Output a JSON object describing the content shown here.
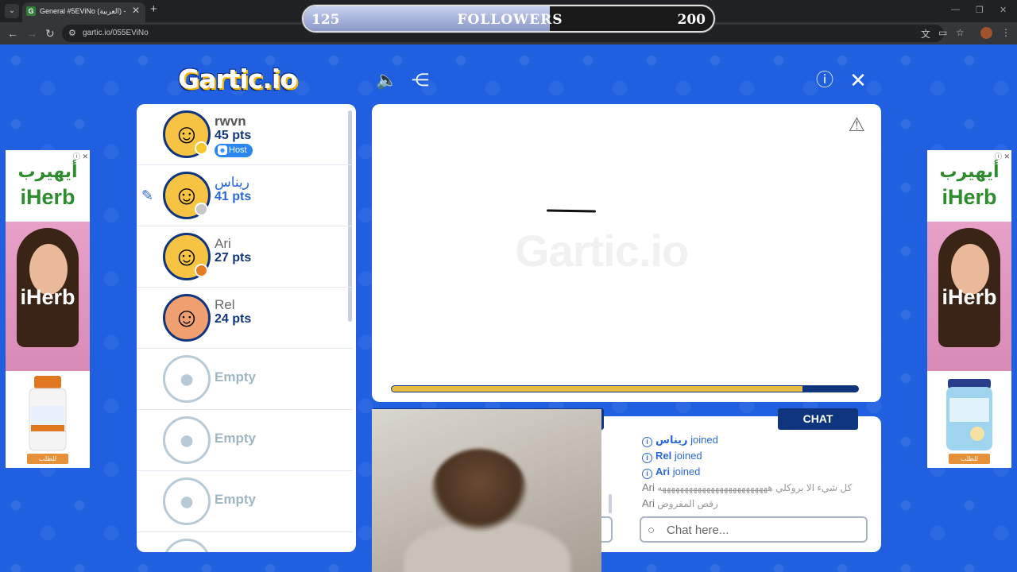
{
  "browser": {
    "tab_title": "General #5EViNo (العربية) - Gar",
    "url": "gartic.io/055EViNo"
  },
  "followers": {
    "current": "125",
    "label": "FOLLOWERS",
    "goal": "200",
    "progress": 0.6
  },
  "logo": "Gartic.io",
  "players": [
    {
      "name": "rwvn",
      "points": "45 pts",
      "host_label": "Host",
      "status_color": "#f6c82a"
    },
    {
      "name": "ريناس",
      "points": "41 pts",
      "drawing": true,
      "status_color": "#c7c7c7"
    },
    {
      "name": "Ari",
      "points": "27 pts",
      "status_color": "#e57d1e"
    },
    {
      "name": "Rel",
      "points": "24 pts"
    },
    {
      "name": "Empty"
    },
    {
      "name": "Empty"
    },
    {
      "name": "Empty"
    }
  ],
  "canvas": {
    "watermark": "Gartic.io",
    "timer_progress": 0.88
  },
  "chat": {
    "tab_label": "CHAT",
    "messages": [
      {
        "user": "ريناس",
        "text": "joined",
        "system": true
      },
      {
        "user": "Rel",
        "text": "joined",
        "system": true
      },
      {
        "user": "Ari",
        "text": "joined",
        "system": true
      },
      {
        "user": "Ari",
        "text": "كل شيء الا بروكلي هههههههههههههههههههههههههه",
        "system": false
      },
      {
        "user": "Ari",
        "text": "رقص المفروض",
        "system": false
      }
    ],
    "placeholder": "Chat here..."
  },
  "ads": {
    "brand_ar": "أيهيرب",
    "brand": "iHerb",
    "cta": "للطلب"
  },
  "colors": {
    "page_bg": "#1f5fe0",
    "navy": "#10357f",
    "accent_blue": "#2a67e0",
    "timer_fill": "#e8bb45"
  }
}
